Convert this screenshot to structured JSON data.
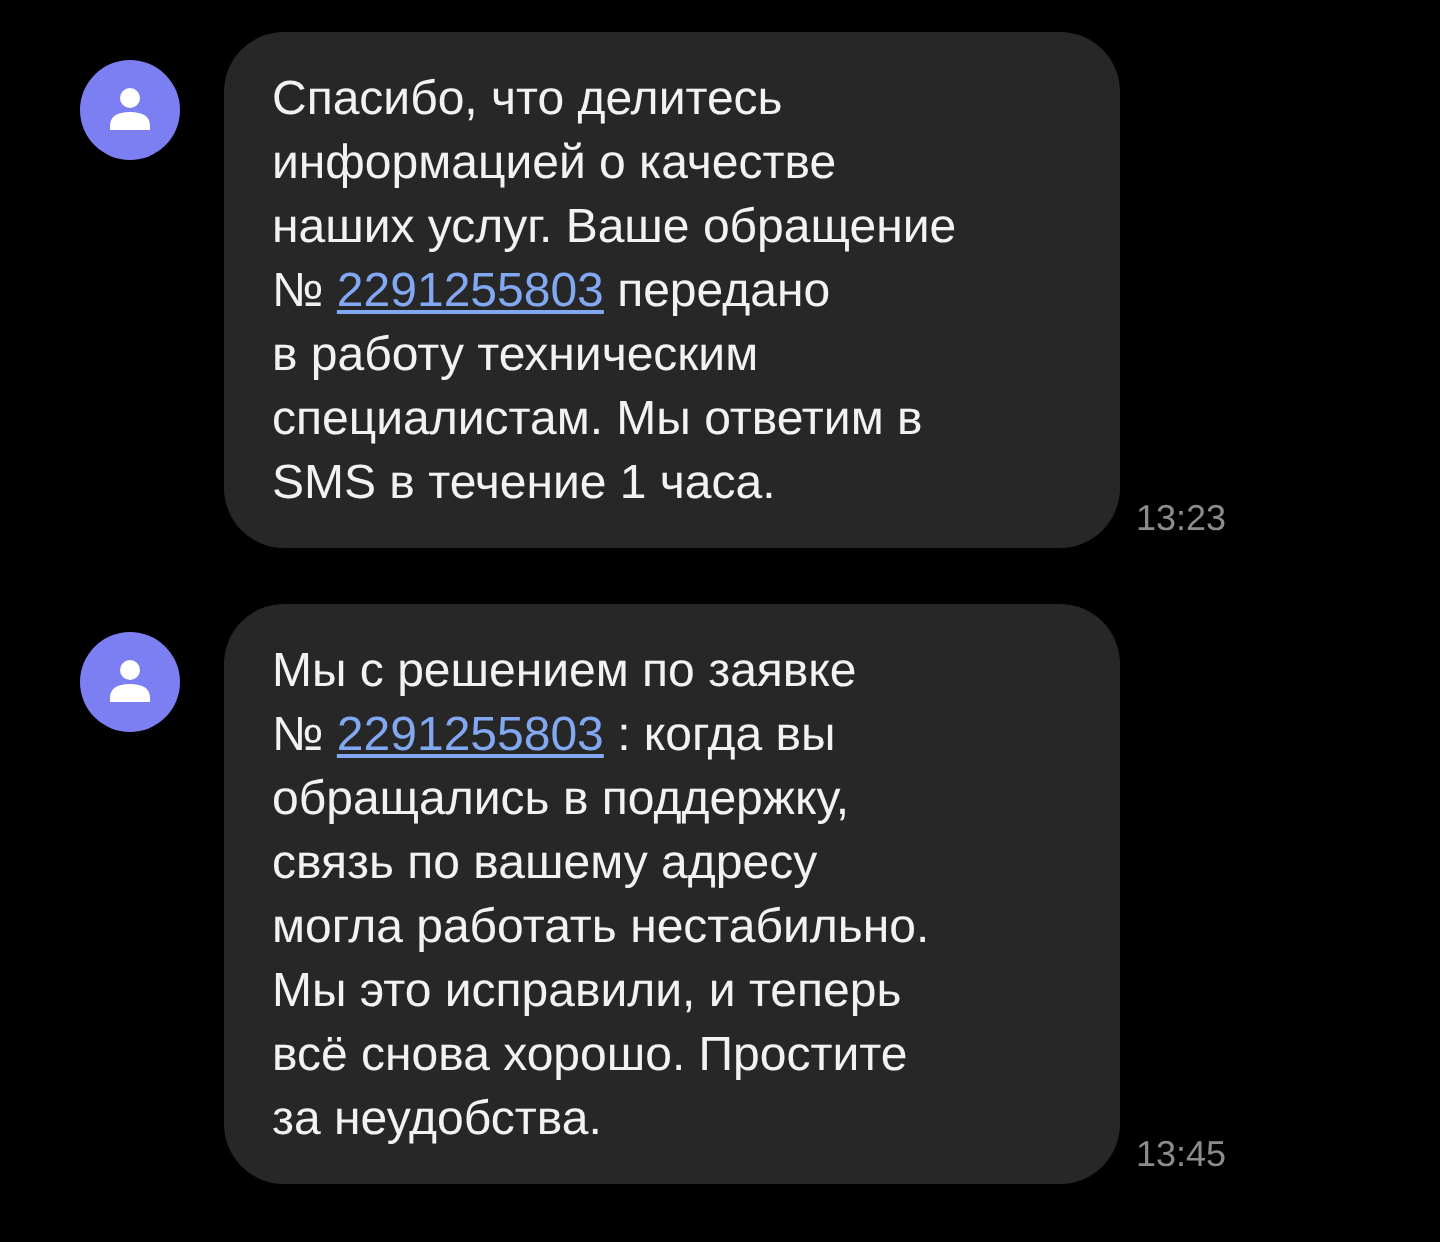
{
  "messages": [
    {
      "text_before": "Спасибо, что делитесь\nинформацией о качестве\nнаших услуг. Ваше обращение\n№ ",
      "link": "2291255803",
      "text_after": " передано\nв работу техническим\nспециалистам. Мы ответим в\nSMS в течение 1 часа.",
      "time": "13:23"
    },
    {
      "text_before": "Мы с решением по заявке\n№ ",
      "link": "2291255803",
      "text_after": " : когда вы\nобращались в поддержку,\nсвязь по вашему адресу\nмогла работать нестабильно.\nМы это исправили, и теперь\nвсё снова хорошо. Простите\nза неудобства.",
      "time": "13:45"
    }
  ]
}
